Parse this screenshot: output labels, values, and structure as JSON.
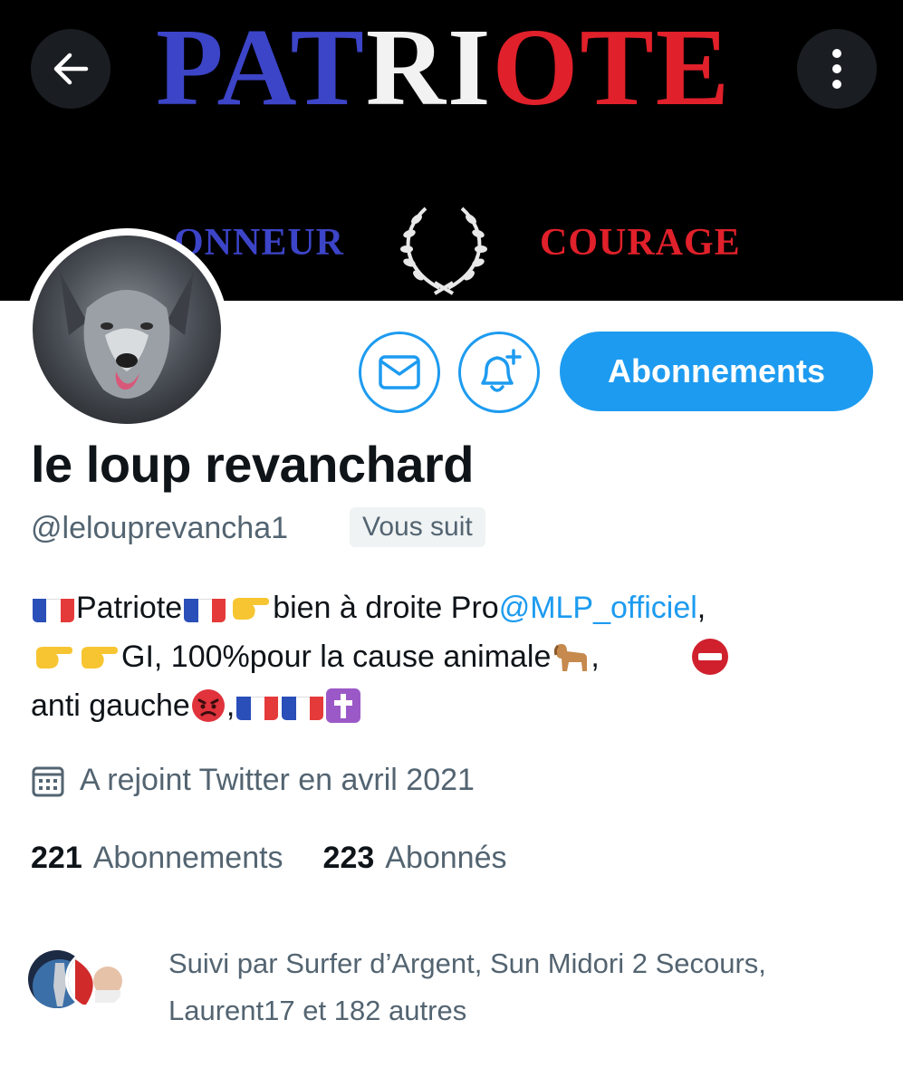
{
  "banner": {
    "title_part1": "PAT",
    "title_part2": "RI",
    "title_part3": "OTE",
    "word_left": "ONNEUR",
    "word_right": "COURAGE"
  },
  "nav": {
    "back_icon": "arrow-left-icon",
    "more_icon": "more-vertical-icon"
  },
  "profile": {
    "display_name": "le loup revanchard",
    "handle": "@lelouprevancha1",
    "follows_you": "Vous suit",
    "follow_button": "Abonnements",
    "bio": {
      "line1_a": "Patriote ",
      "line1_b": "bien à droite Pro ",
      "mention": "@MLP_officiel",
      "line1_c": ",",
      "line2_a": "GI, 100%pour la cause animale ",
      "line2_b": ",",
      "line3_a": "anti gauche",
      "line3_b": ","
    },
    "joined": "A rejoint Twitter en avril 2021",
    "following_count": "221",
    "following_label": "Abonnements",
    "followers_count": "223",
    "followers_label": "Abonnés",
    "followed_by": "Suivi par Surfer d’Argent, Sun Midori 2 Secours, Laurent17 et 182 autres"
  },
  "colors": {
    "accent": "#1d9bf0",
    "secondary_text": "#536471",
    "primary_text": "#0f1419",
    "flag_blue": "#2a4fb8",
    "flag_red": "#e53a3a"
  }
}
